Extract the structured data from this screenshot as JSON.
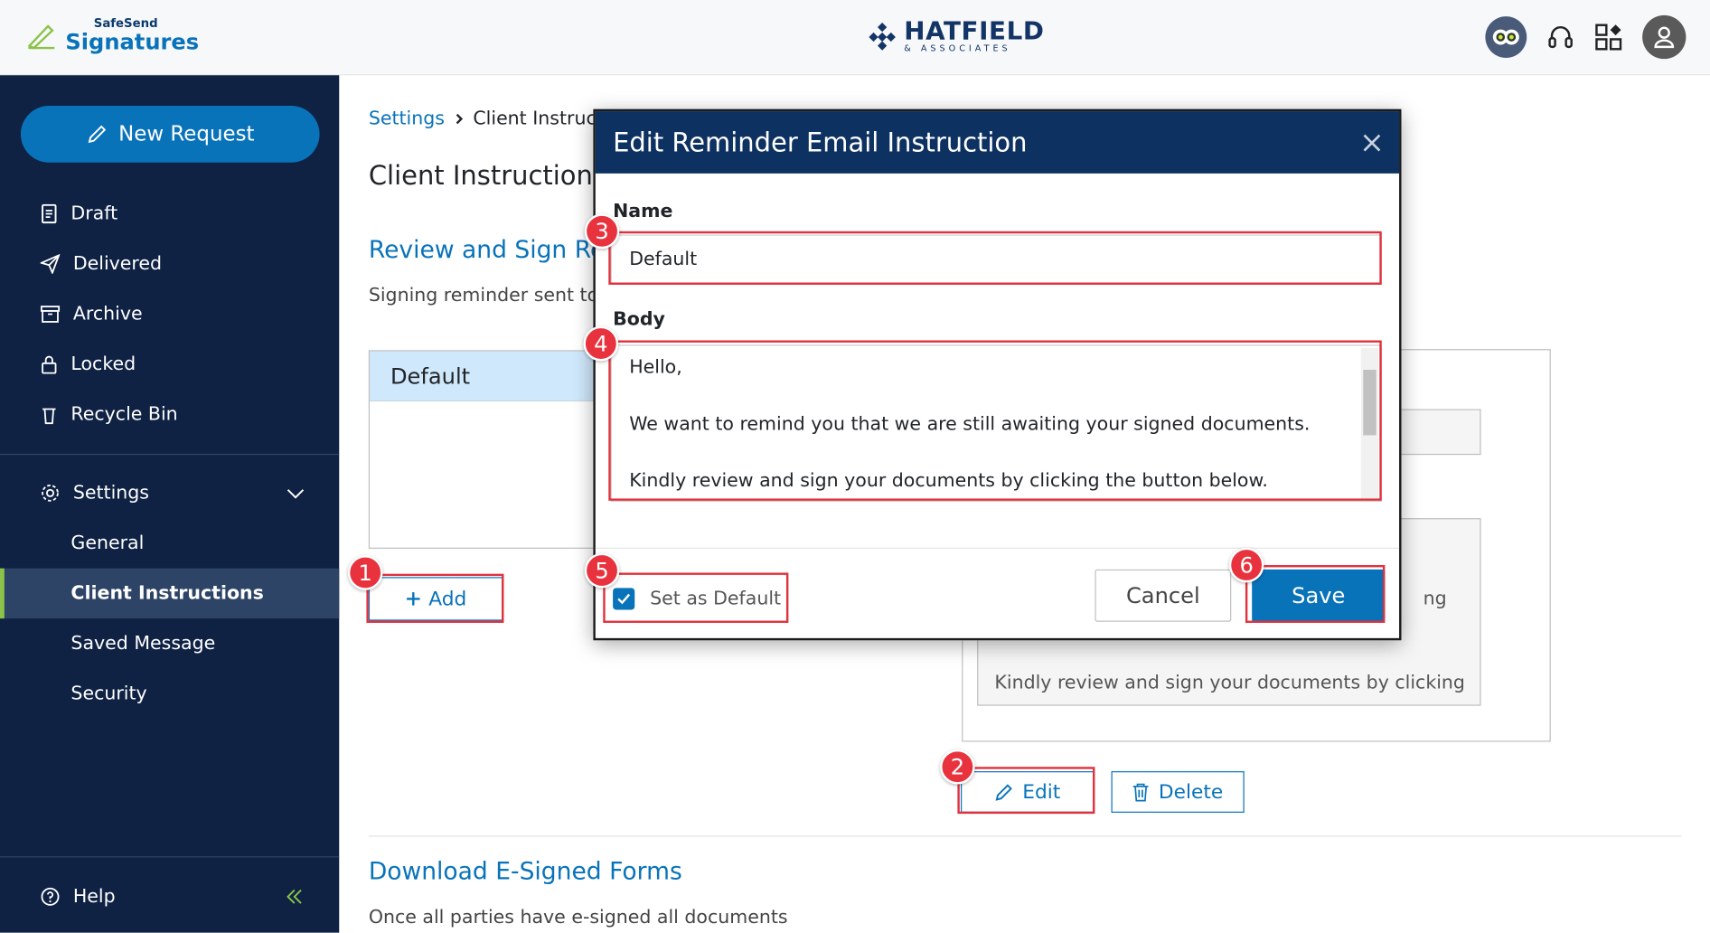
{
  "header": {
    "logo_small": "SafeSend",
    "logo_big": "Signatures",
    "firm_name": "HATFIELD",
    "firm_sub": "& ASSOCIATES"
  },
  "sidebar": {
    "new_request": "New Request",
    "items": [
      {
        "label": "Draft"
      },
      {
        "label": "Delivered"
      },
      {
        "label": "Archive"
      },
      {
        "label": "Locked"
      },
      {
        "label": "Recycle Bin"
      }
    ],
    "settings_label": "Settings",
    "sub_items": [
      {
        "label": "General"
      },
      {
        "label": "Client Instructions"
      },
      {
        "label": "Saved Message"
      },
      {
        "label": "Security"
      }
    ],
    "help_label": "Help"
  },
  "main": {
    "breadcrumb_link": "Settings",
    "breadcrumb_current": "Client Instruct",
    "page_title": "Client Instructions",
    "section_title": "Review and Sign Re",
    "section_desc": "Signing reminder sent to c",
    "list_items": [
      "Default"
    ],
    "add_label": "Add",
    "panel_text_1": "ng",
    "panel_text_2": "Kindly review and sign your documents by clicking",
    "edit_label": "Edit",
    "delete_label": "Delete",
    "section2_title": "Download E-Signed Forms",
    "section2_desc": "Once all parties have e-signed all documents"
  },
  "modal": {
    "title": "Edit Reminder Email Instruction",
    "name_label": "Name",
    "name_value": "Default",
    "body_label": "Body",
    "body_lines": [
      "Hello,",
      "We want to remind you that we are still awaiting your signed documents.",
      "Kindly review and sign your documents by clicking the button below."
    ],
    "set_default_label": "Set as Default",
    "set_default_checked": true,
    "cancel_label": "Cancel",
    "save_label": "Save"
  },
  "annotations": [
    "1",
    "2",
    "3",
    "4",
    "5",
    "6"
  ],
  "colors": {
    "sidebar_bg": "#0f2244",
    "accent": "#0973ba",
    "modal_header": "#0d3161",
    "highlight": "#e0323e",
    "active_marker": "#8bc34a"
  }
}
